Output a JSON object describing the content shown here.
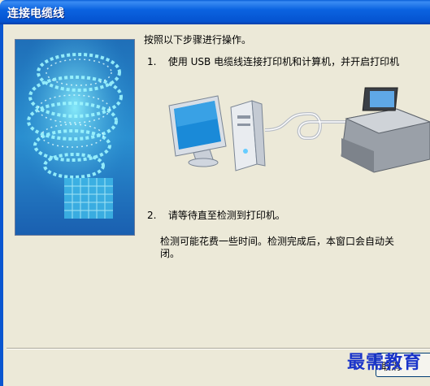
{
  "window": {
    "title": "连接电缆线"
  },
  "instructions": {
    "intro": "按照以下步骤进行操作。",
    "step1": {
      "number": "1.",
      "text": "使用 USB 电缆线连接打印机和计算机，并开启打印机"
    },
    "step2": {
      "number": "2.",
      "text": "请等待直至检测到打印机。"
    },
    "step2_note_line1": "检测可能花费一些时间。检测完成后，本窗口会自动关",
    "step2_note_line2": "闭。"
  },
  "footer": {
    "button_label": "取消"
  },
  "watermark": {
    "text": "最需教育"
  },
  "colors": {
    "titlebar": "#0553d0",
    "dialog_bg": "#ece9d8",
    "watermark": "#1a34c9"
  }
}
